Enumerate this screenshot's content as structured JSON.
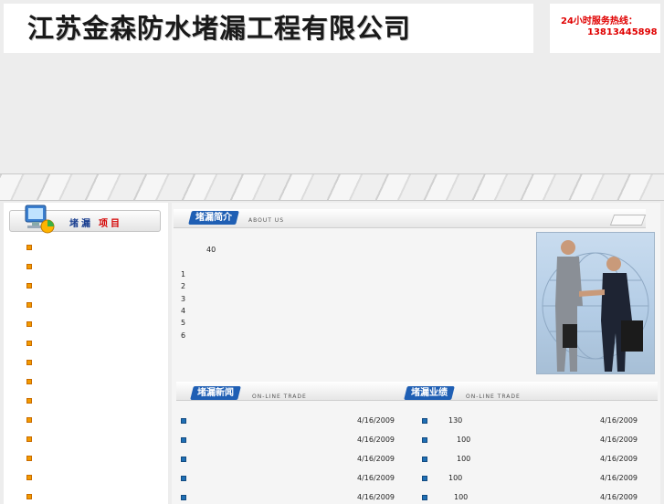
{
  "header": {
    "company_name": "江苏金森防水堵漏工程有限公司",
    "hotline_label": "24小时服务热线：",
    "hotline_phone": "13813445898"
  },
  "sidebar": {
    "title_a": "堵漏",
    "title_b": "项目",
    "item_count": 14
  },
  "about": {
    "tab": "堵漏简介",
    "subtitle": "ABOUT US",
    "intro_num": "40",
    "list": [
      "1",
      "2",
      "3",
      "4",
      "5",
      "6"
    ]
  },
  "news": {
    "tab": "堵漏新闻",
    "subtitle": "ON-LINE TRADE",
    "rows": [
      {
        "text": "",
        "date": "4/16/2009"
      },
      {
        "text": "",
        "date": "4/16/2009"
      },
      {
        "text": "",
        "date": "4/16/2009"
      },
      {
        "text": "",
        "date": "4/16/2009"
      },
      {
        "text": "",
        "date": "4/16/2009"
      }
    ]
  },
  "cases": {
    "tab": "堵漏业绩",
    "subtitle": "ON-LINE TRADE",
    "rows": [
      {
        "text": "130",
        "date": "4/16/2009"
      },
      {
        "text": "100",
        "date": "4/16/2009"
      },
      {
        "text": "100",
        "date": "4/16/2009"
      },
      {
        "text": "100",
        "date": "4/16/2009"
      },
      {
        "text": "100",
        "date": "4/16/2009"
      }
    ]
  },
  "colors": {
    "accent": "#1f5fb4",
    "hotline": "#e00000",
    "bullet": "#f29a00"
  }
}
